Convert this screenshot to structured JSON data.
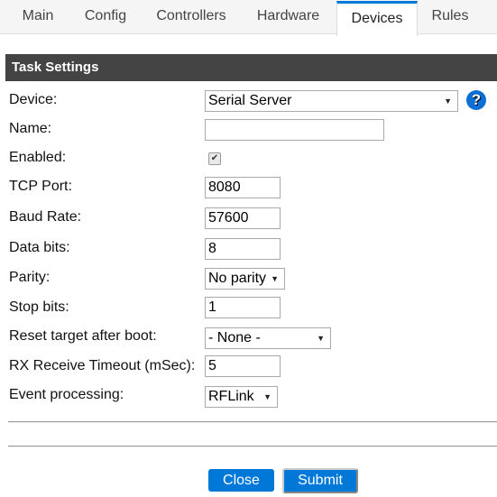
{
  "tabs": [
    {
      "label": "Main",
      "active": false
    },
    {
      "label": "Config",
      "active": false
    },
    {
      "label": "Controllers",
      "active": false
    },
    {
      "label": "Hardware",
      "active": false
    },
    {
      "label": "Devices",
      "active": true
    },
    {
      "label": "Rules",
      "active": false
    }
  ],
  "section": {
    "title": "Task Settings"
  },
  "form": {
    "device": {
      "label": "Device:",
      "value": "Serial Server"
    },
    "name": {
      "label": "Name:",
      "value": ""
    },
    "enabled": {
      "label": "Enabled:",
      "checked": true,
      "check_glyph": "✔"
    },
    "tcp_port": {
      "label": "TCP Port:",
      "value": "8080"
    },
    "baud_rate": {
      "label": "Baud Rate:",
      "value": "57600"
    },
    "data_bits": {
      "label": "Data bits:",
      "value": "8"
    },
    "parity": {
      "label": "Parity:",
      "value": "No parity"
    },
    "stop_bits": {
      "label": "Stop bits:",
      "value": "1"
    },
    "reset_target": {
      "label": "Reset target after boot:",
      "value": "- None -"
    },
    "rx_timeout": {
      "label": "RX Receive Timeout (mSec):",
      "value": "5"
    },
    "event_processing": {
      "label": "Event processing:",
      "value": "RFLink"
    }
  },
  "icons": {
    "help": "?",
    "dropdown_arrow": "▼"
  },
  "buttons": {
    "close": "Close",
    "submit": "Submit"
  },
  "colors": {
    "accent": "#0078d7",
    "header_bg": "#444444"
  }
}
